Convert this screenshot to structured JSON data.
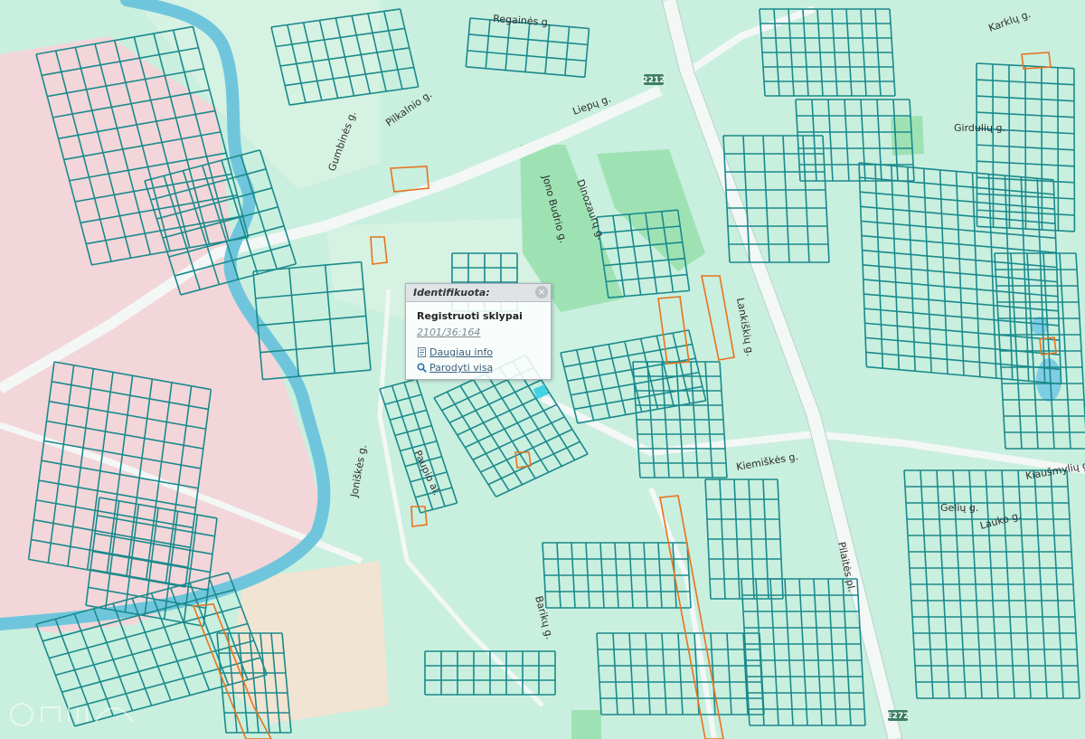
{
  "popup": {
    "title": "Identifikuota:",
    "close_symbol": "×",
    "layer_name": "Registruoti sklypai",
    "parcel_id": "2101/36:164",
    "more_info_label": "Daugiau info",
    "show_all_label": "Parodyti visą"
  },
  "icons": {
    "close": "close-icon",
    "more_info": "document-icon",
    "show_all": "magnifier-icon"
  },
  "map": {
    "colors": {
      "background": "#c9efdf",
      "parcel_line": "#1a8a8c",
      "river": "#6fc6dc",
      "industrial": "#f2d6d9",
      "park": "#9ee2b4",
      "road": "#f3f7f6",
      "highlight": "#e8731c",
      "shield": "#3d7f66"
    },
    "streets": [
      "Regainės g.",
      "Liepų g.",
      "Gumbinės g.",
      "Pilkalnio g.",
      "Jono Budrio g.",
      "Dinozaurų g.",
      "Lankiškių g.",
      "Paupio al.",
      "Joniškės g.",
      "Kiemiškės g.",
      "Pilaitės pl.",
      "Barikų g.",
      "Girdulių g.",
      "Karklų g.",
      "Gelių g.",
      "Lauko g.",
      "Kiaušmylių g."
    ],
    "road_shields": [
      "2212",
      "E272"
    ]
  }
}
